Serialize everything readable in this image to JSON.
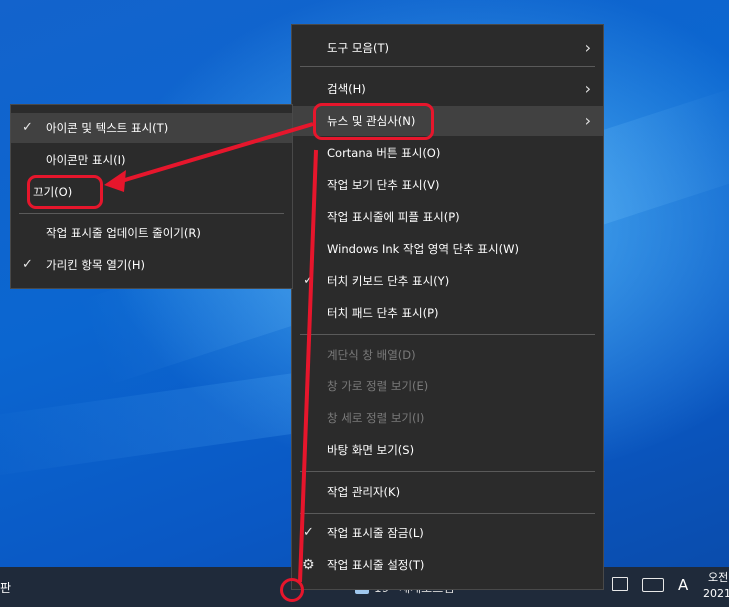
{
  "main_menu": {
    "items": [
      {
        "label": "도구 모음(T)",
        "submenu": true
      },
      {
        "label": "검색(H)",
        "submenu": true
      },
      {
        "label": "뉴스 및 관심사(N)",
        "submenu": true,
        "highlighted": true
      },
      {
        "label": "Cortana 버튼 표시(O)"
      },
      {
        "label": "작업 보기 단추 표시(V)"
      },
      {
        "label": "작업 표시줄에 피플 표시(P)"
      },
      {
        "label": "Windows Ink 작업 영역 단추 표시(W)"
      },
      {
        "label": "터치 키보드 단추 표시(Y)",
        "checked": true
      },
      {
        "label": "터치 패드 단추 표시(P)"
      },
      {
        "label": "계단식 창 배열(D)",
        "disabled": true
      },
      {
        "label": "창 가로 정렬 보기(E)",
        "disabled": true
      },
      {
        "label": "창 세로 정렬 보기(I)",
        "disabled": true
      },
      {
        "label": "바탕 화면 보기(S)"
      },
      {
        "label": "작업 관리자(K)"
      },
      {
        "label": "작업 표시줄 잠금(L)",
        "checked": true
      },
      {
        "label": "작업 표시줄 설정(T)",
        "icon": "gear-icon"
      }
    ]
  },
  "sub_menu": {
    "items": [
      {
        "label": "아이콘 및 텍스트 표시(T)",
        "checked": true,
        "highlighted": true
      },
      {
        "label": "아이콘만 표시(I)"
      },
      {
        "label": "끄기(O)"
      },
      {
        "label": "작업 표시줄 업데이트 줄이기(R)"
      },
      {
        "label": "가리킨 항목 열기(H)",
        "checked": true
      }
    ]
  },
  "taskbar": {
    "left_text": "판",
    "news_text": "19° 세계소트템",
    "ime_label": "A",
    "clock_line1": "오전",
    "clock_line2": "2021"
  },
  "glyphs": {
    "chevron": "›",
    "check": "✓",
    "gear": "⚙"
  },
  "colors": {
    "menu_bg": "#2b2b2b",
    "menu_highlight": "#414141",
    "annotation_red": "#e6162c",
    "taskbar_bg": "#1f2a3a"
  }
}
